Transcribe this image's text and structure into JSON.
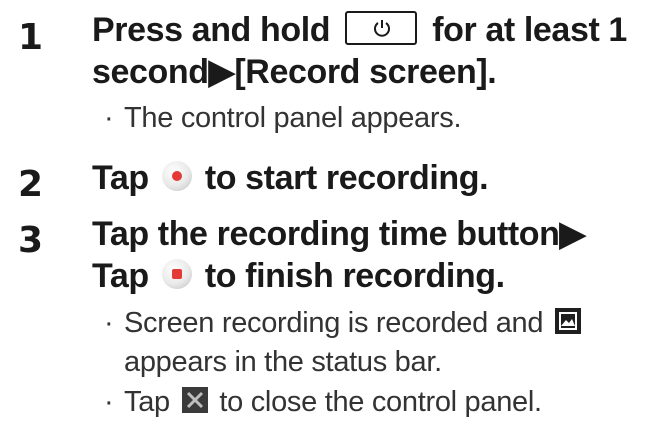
{
  "steps": [
    {
      "number": "1",
      "title_part1": "Press and hold",
      "title_part2": "for at least 1",
      "title_line2": "second▶[Record screen].",
      "bullets": [
        "The control panel appears."
      ]
    },
    {
      "number": "2",
      "title_part1": "Tap",
      "title_part2": "to start recording.",
      "bullets": []
    },
    {
      "number": "3",
      "title_line1": "Tap the recording time button▶",
      "title_part1": "Tap",
      "title_part2": "to finish recording.",
      "bullets": [
        "Screen recording is recorded and",
        "appears in the status bar.",
        "Tap",
        "to close the control panel."
      ]
    }
  ],
  "bullet_char": "·",
  "icons": {
    "power": "power-key-icon",
    "record_start": "record-start-icon",
    "record_stop": "record-stop-icon",
    "screenshot": "image-status-icon",
    "close": "close-icon"
  },
  "colors": {
    "text": "#1a1a1a",
    "record_red": "#e53935"
  }
}
